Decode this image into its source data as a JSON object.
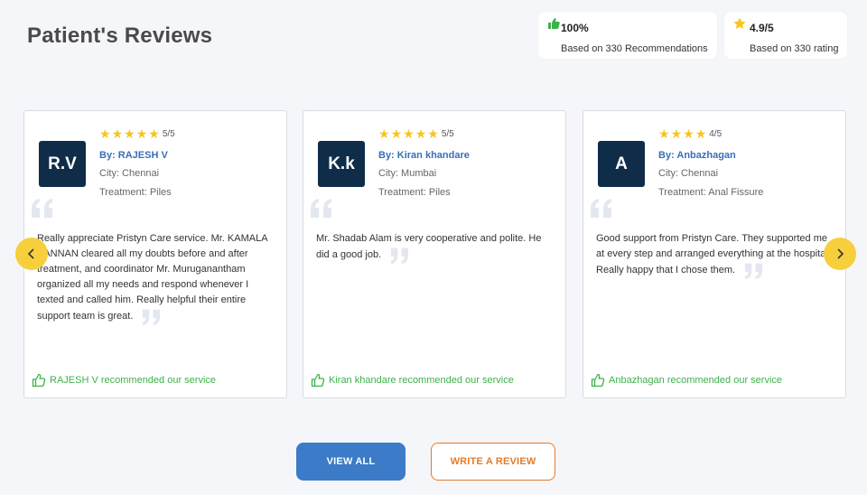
{
  "page": {
    "title": "Patient's Reviews"
  },
  "stats": [
    {
      "value": "100%",
      "label": "Based on 330 Recommendations",
      "icon": "thumbs-up-icon",
      "color": "#3cb24a"
    },
    {
      "value": "4.9/5",
      "label": "Based on 330 rating",
      "icon": "star-icon",
      "color": "#f7c51e"
    }
  ],
  "reviews": [
    {
      "initials": "R.V",
      "stars": 5,
      "rating": "5/5",
      "by": "By: RAJESH V",
      "city": "City: Chennai",
      "treatment": "Treatment: Piles",
      "text": "Really appreciate Pristyn Care service. Mr. KAMALA KANNAN cleared all my doubts before and after treatment, and coordinator Mr. Muruganantham organized all my needs and respond whenever I texted and called him. Really helpful their entire support team is great.",
      "recommend": "RAJESH V recommended our service"
    },
    {
      "initials": "K.k",
      "stars": 5,
      "rating": "5/5",
      "by": "By: Kiran khandare",
      "city": "City: Mumbai",
      "treatment": "Treatment: Piles",
      "text": "Mr. Shadab Alam is very cooperative and polite. He did a good job.",
      "recommend": "Kiran khandare recommended our service"
    },
    {
      "initials": "A",
      "stars": 4,
      "rating": "4/5",
      "by": "By: Anbazhagan",
      "city": "City: Chennai",
      "treatment": "Treatment: Anal Fissure",
      "text": "Good support from Pristyn Care. They supported me at every step and arranged everything at the hospital. Really happy that I chose them.",
      "recommend": "Anbazhagan recommended our service"
    }
  ],
  "nav": {
    "prev_icon": "chevron-left-icon",
    "next_icon": "chevron-right-icon"
  },
  "buttons": {
    "view_all": "VIEW ALL",
    "write_review": "WRITE A REVIEW"
  },
  "colors": {
    "accent": "#3b7bc7",
    "star": "#f7c51e",
    "recommend": "#3cb24a",
    "avatar_bg": "#0f2d48",
    "cta_outline": "#e37b2a",
    "arrow_bg": "#f7cf3c"
  }
}
